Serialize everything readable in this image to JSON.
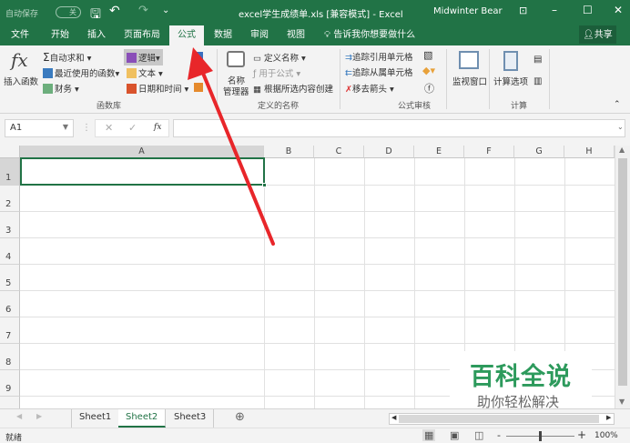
{
  "title_bar": {
    "autosave": "自动保存",
    "autosave_state": "关",
    "title": "excel学生成绩单.xls  [兼容模式]  -  Excel",
    "user": "Midwinter Bear"
  },
  "tabs": [
    "文件",
    "开始",
    "插入",
    "页面布局",
    "公式",
    "数据",
    "审阅",
    "视图"
  ],
  "active_tab": "公式",
  "tell_me": "告诉我你想要做什么",
  "share": "共享",
  "ribbon": {
    "insert_function": "插入函数",
    "autosum": "自动求和",
    "recent": "最近使用的函数",
    "financial": "财务",
    "logical": "逻辑",
    "text": "文本",
    "datetime": "日期和时间",
    "group_library": "函数库",
    "name_manager_1": "名称",
    "name_manager_2": "管理器",
    "define_name": "定义名称",
    "use_in_formula": "用于公式",
    "create_from_selection": "根据所选内容创建",
    "group_names": "定义的名称",
    "trace_precedents": "追踪引用单元格",
    "trace_dependents": "追踪从属单元格",
    "remove_arrows": "移去箭头",
    "group_audit": "公式审核",
    "watch_window": "监视窗口",
    "calc_options": "计算选项",
    "group_calc": "计算"
  },
  "formula_bar": {
    "name_box": "A1",
    "fx": "fx",
    "value": ""
  },
  "columns": [
    "A",
    "B",
    "C",
    "D",
    "E",
    "F",
    "G",
    "H"
  ],
  "rows": [
    "1",
    "2",
    "3",
    "4",
    "5",
    "6",
    "7",
    "8",
    "9"
  ],
  "sheets": [
    "Sheet1",
    "Sheet2",
    "Sheet3"
  ],
  "active_sheet": "Sheet2",
  "status": {
    "ready": "就绪",
    "zoom": "100%"
  },
  "watermark": {
    "brand": "百科全说",
    "slogan": "助你轻松解决"
  },
  "colors": {
    "excel_green": "#217346",
    "arrow": "#e8262a"
  }
}
